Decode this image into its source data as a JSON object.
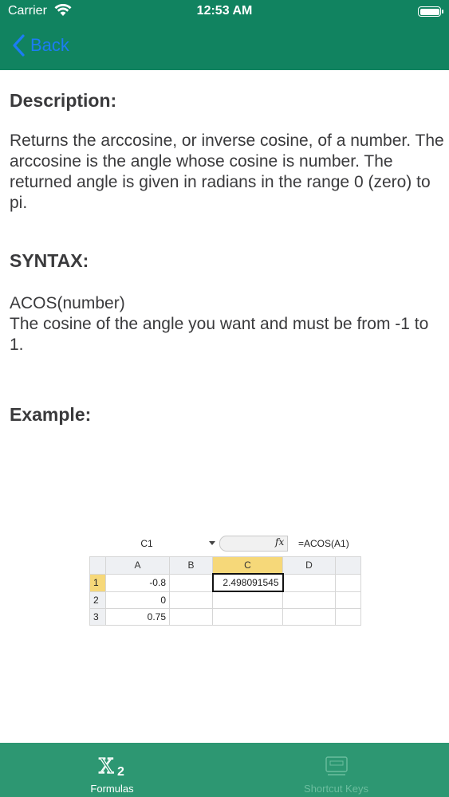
{
  "status": {
    "carrier": "Carrier",
    "time": "12:53 AM"
  },
  "nav": {
    "back_label": "Back"
  },
  "description": {
    "title": "Description:",
    "body": "Returns the arccosine, or inverse cosine, of a number. The arccosine is the angle whose cosine is number. The returned angle is given in radians in the range 0 (zero) to pi."
  },
  "syntax": {
    "title": "SYNTAX:",
    "line1": "ACOS(number)",
    "line2": "The cosine of the angle you want and must be from -1 to 1."
  },
  "example": {
    "title": "Example:",
    "sheet": {
      "name_box": "C1",
      "fx_symbol": "fx",
      "formula": "=ACOS(A1)",
      "columns": [
        "A",
        "B",
        "C",
        "D"
      ],
      "rows": [
        {
          "num": "1",
          "a": "-0.8",
          "b": "",
          "c": "2.498091545",
          "d": ""
        },
        {
          "num": "2",
          "a": "0",
          "b": "",
          "c": "",
          "d": ""
        },
        {
          "num": "3",
          "a": "0.75",
          "b": "",
          "c": "",
          "d": ""
        }
      ]
    }
  },
  "tabs": [
    {
      "label": "Formulas",
      "icon": "x2-formula-icon"
    },
    {
      "label": "Shortcut Keys",
      "icon": "keyboard-icon"
    }
  ],
  "colors": {
    "header": "#118360",
    "tabbar": "#2d9772",
    "back": "#1c7cf4"
  }
}
